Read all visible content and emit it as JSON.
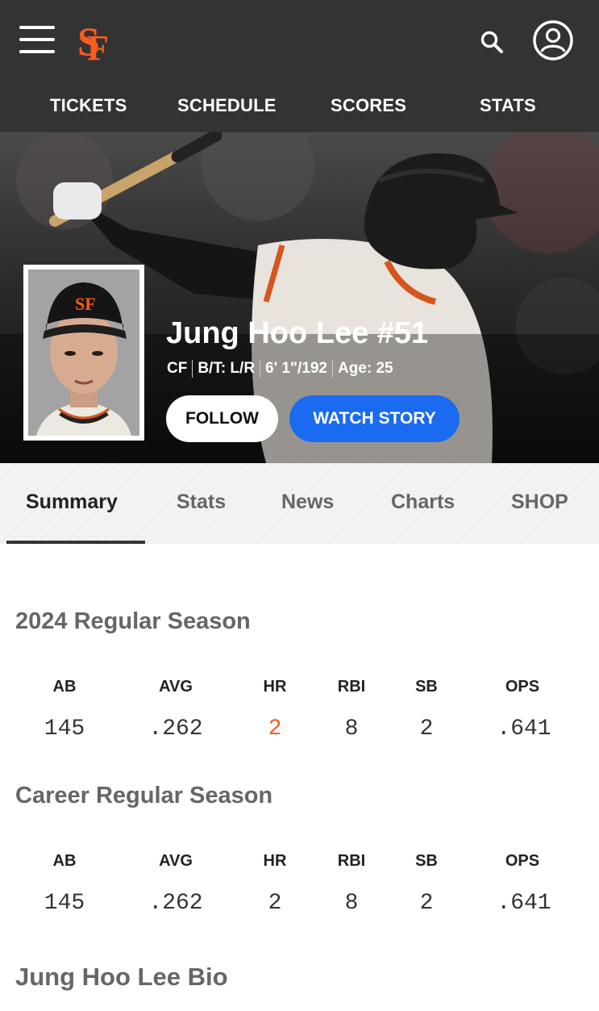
{
  "brand": {
    "logo_letters": "SF",
    "accent": "#fd5a1e",
    "header_bg": "#333333"
  },
  "header": {
    "menu_icon": "hamburger-icon",
    "search_icon": "search-icon",
    "account_icon": "account-icon",
    "nav": [
      "TICKETS",
      "SCHEDULE",
      "SCORES",
      "STATS"
    ]
  },
  "player": {
    "name": "Jung Hoo Lee #51",
    "position": "CF",
    "bats_throws": "B/T: L/R",
    "height_weight": "6' 1\"/192",
    "age": "Age: 25",
    "cap_logo": "SF",
    "follow_label": "FOLLOW",
    "watch_label": "WATCH STORY",
    "watch_color": "#1a6bf0"
  },
  "tabs": [
    "Summary",
    "Stats",
    "News",
    "Charts",
    "SHOP"
  ],
  "active_tab": "Summary",
  "season": {
    "title": "2024 Regular Season",
    "headers": [
      "AB",
      "AVG",
      "HR",
      "RBI",
      "SB",
      "OPS"
    ],
    "values": [
      "145",
      ".262",
      "2",
      "8",
      "2",
      ".641"
    ],
    "highlight_color": "#fd5a1e"
  },
  "career": {
    "title": "Career Regular Season",
    "headers": [
      "AB",
      "AVG",
      "HR",
      "RBI",
      "SB",
      "OPS"
    ],
    "values": [
      "145",
      ".262",
      "2",
      "8",
      "2",
      ".641"
    ]
  },
  "bio": {
    "title": "Jung Hoo Lee Bio"
  }
}
